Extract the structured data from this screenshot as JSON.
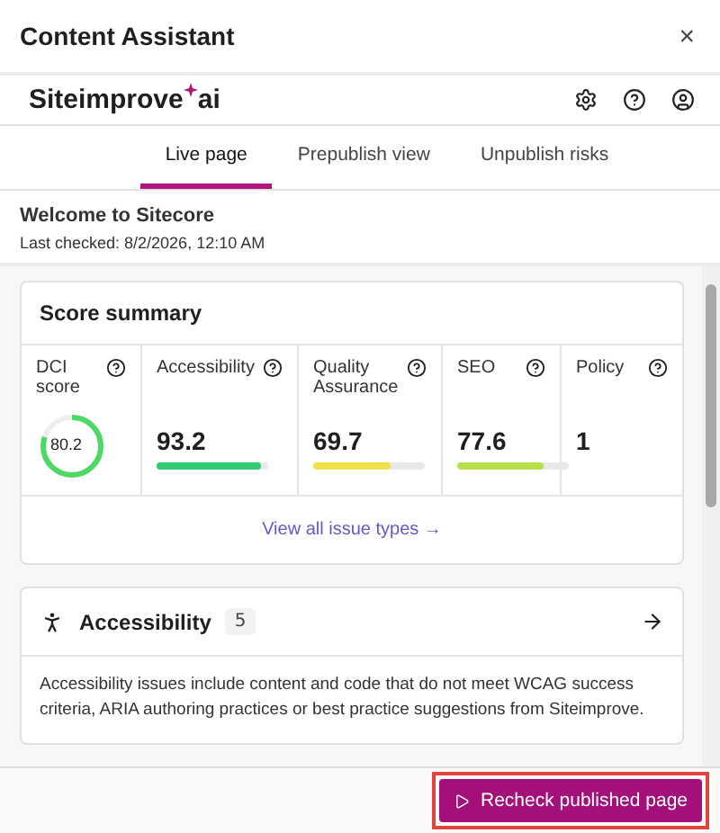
{
  "window": {
    "title": "Content Assistant",
    "close": "×"
  },
  "brand": {
    "name": "Siteimprove",
    "suffix": "ai"
  },
  "tabs": [
    {
      "label": "Live page",
      "selected": true
    },
    {
      "label": "Prepublish view",
      "selected": false
    },
    {
      "label": "Unpublish risks",
      "selected": false
    }
  ],
  "page": {
    "title": "Welcome to Sitecore",
    "last_checked": "Last checked: 8/2/2026, 12:10 AM"
  },
  "score_summary": {
    "title": "Score summary",
    "scores": [
      {
        "kind": "donut",
        "label": "DCI score",
        "value": "80.2",
        "color": "#4cd964"
      },
      {
        "kind": "bar",
        "label": "Accessibility",
        "value": "93.2",
        "level": 0.93,
        "color": "#2ecc71"
      },
      {
        "kind": "bar",
        "label": "Quality Assurance",
        "value": "69.7",
        "level": 0.7,
        "color": "#f0e14a"
      },
      {
        "kind": "bar",
        "label": "SEO",
        "value": "77.6",
        "level": 0.78,
        "color": "#b5e04a"
      },
      {
        "kind": "count",
        "label": "Policy",
        "value": "1"
      }
    ],
    "link": "View all issue types →"
  },
  "issue_card": {
    "title": "Accessibility",
    "count": "5",
    "description": "Accessibility issues include content and code that do not meet WCAG success criteria, ARIA authoring practices or best practice suggestions from Siteimprove."
  },
  "footer": {
    "button": "Recheck published page",
    "highlighted": true
  }
}
